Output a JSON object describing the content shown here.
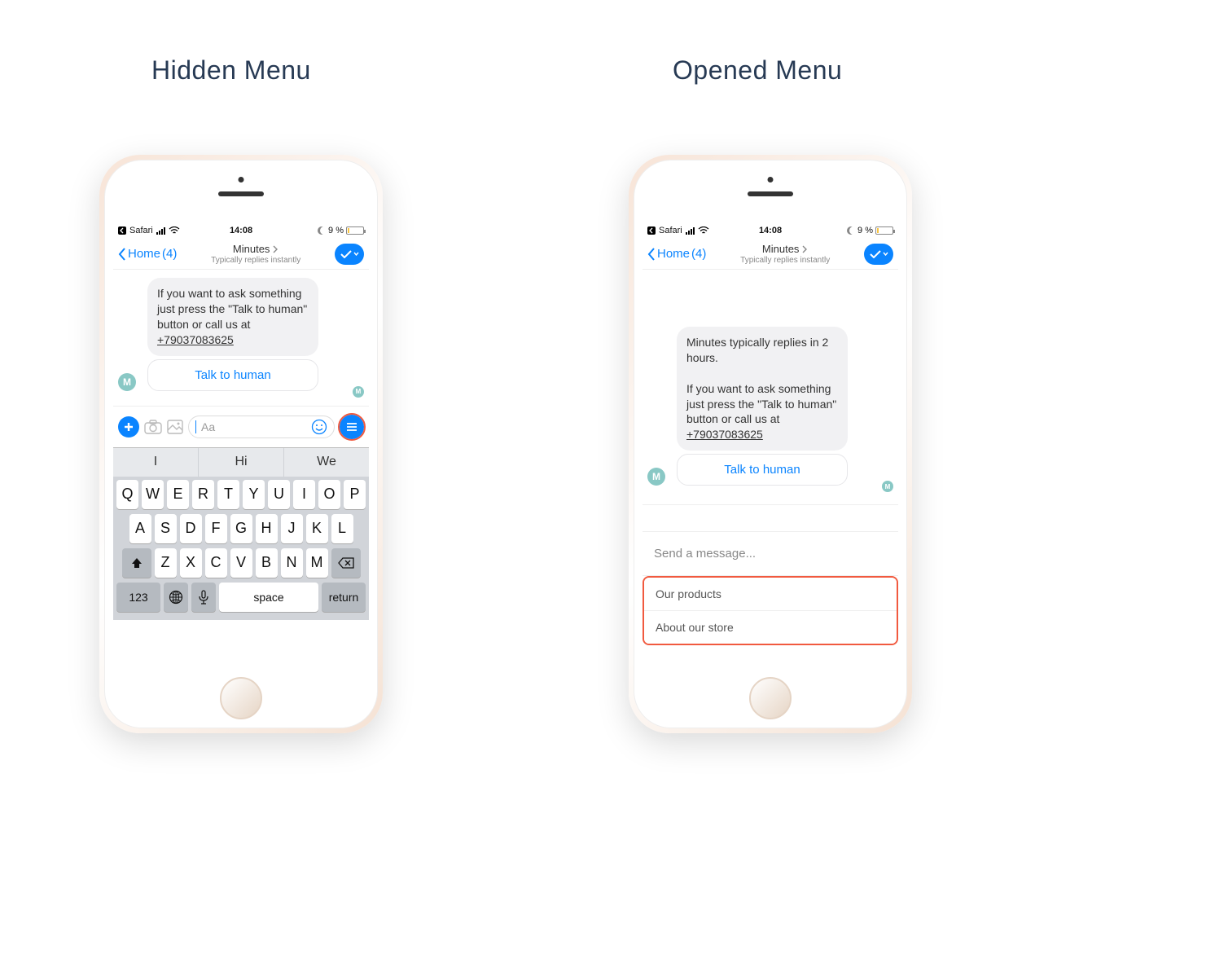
{
  "headings": {
    "left": "Hidden Menu",
    "right": "Opened  Menu"
  },
  "statusbar": {
    "carrier": "Safari",
    "time": "14:08",
    "battery_text": "9 %"
  },
  "header": {
    "back_label": "Home",
    "back_count": "(4)",
    "title": "Minutes",
    "subtitle": "Typically replies instantly"
  },
  "left_phone": {
    "message_text": "If you want to ask something just press the \"Talk to human\" button or call us at ",
    "message_phone": "+79037083625",
    "action_label": "Talk to human",
    "avatar_letter": "M",
    "input_placeholder": "Aa",
    "suggestions": [
      "I",
      "Hi",
      "We"
    ],
    "keyboard": {
      "row1": [
        "Q",
        "W",
        "E",
        "R",
        "T",
        "Y",
        "U",
        "I",
        "O",
        "P"
      ],
      "row2": [
        "A",
        "S",
        "D",
        "F",
        "G",
        "H",
        "J",
        "K",
        "L"
      ],
      "row3": [
        "Z",
        "X",
        "C",
        "V",
        "B",
        "N",
        "M"
      ],
      "num_key": "123",
      "space_key": "space",
      "return_key": "return"
    }
  },
  "right_phone": {
    "message_intro": "Minutes typically replies in 2 hours.",
    "message_text": "If you want to ask something just press the \"Talk to human\" button or call us at ",
    "message_phone": "+79037083625",
    "action_label": "Talk to human",
    "avatar_letter": "M",
    "send_placeholder": "Send a message...",
    "menu_items": [
      "Our products",
      "About our store"
    ]
  }
}
